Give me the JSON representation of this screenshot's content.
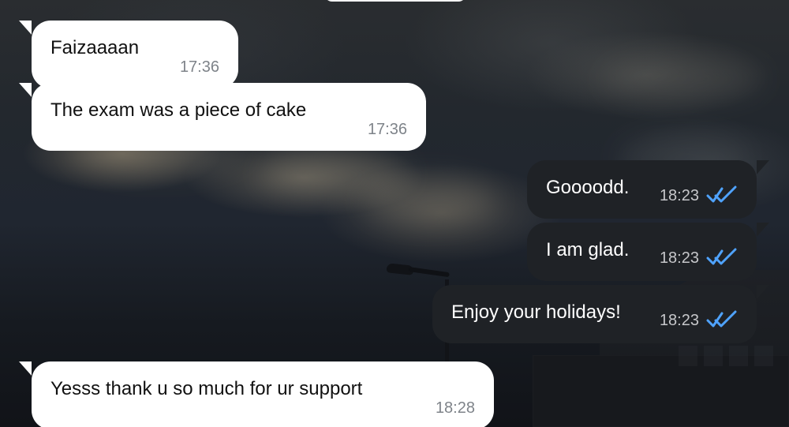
{
  "messages": [
    {
      "text": "Faizaaaan",
      "time": "17:36",
      "direction": "incoming"
    },
    {
      "text": "The exam was a piece of cake",
      "time": "17:36",
      "direction": "incoming"
    },
    {
      "text": "Goooodd.",
      "time": "18:23",
      "direction": "outgoing",
      "status_icon": "double-check-icon"
    },
    {
      "text": "I am glad.",
      "time": "18:23",
      "direction": "outgoing",
      "status_icon": "double-check-icon"
    },
    {
      "text": "Enjoy your holidays!",
      "time": "18:23",
      "direction": "outgoing",
      "status_icon": "double-check-icon"
    },
    {
      "text": "Yesss thank u so much for ur support",
      "time": "18:28",
      "direction": "incoming"
    }
  ],
  "colors": {
    "incoming_bubble": "#ffffff",
    "outgoing_bubble": "#1f2226",
    "incoming_text": "#111111",
    "outgoing_text": "#ffffff",
    "incoming_time": "#7e8389",
    "outgoing_time": "#c6c7ca",
    "read_receipt": "#4fa3ff"
  }
}
